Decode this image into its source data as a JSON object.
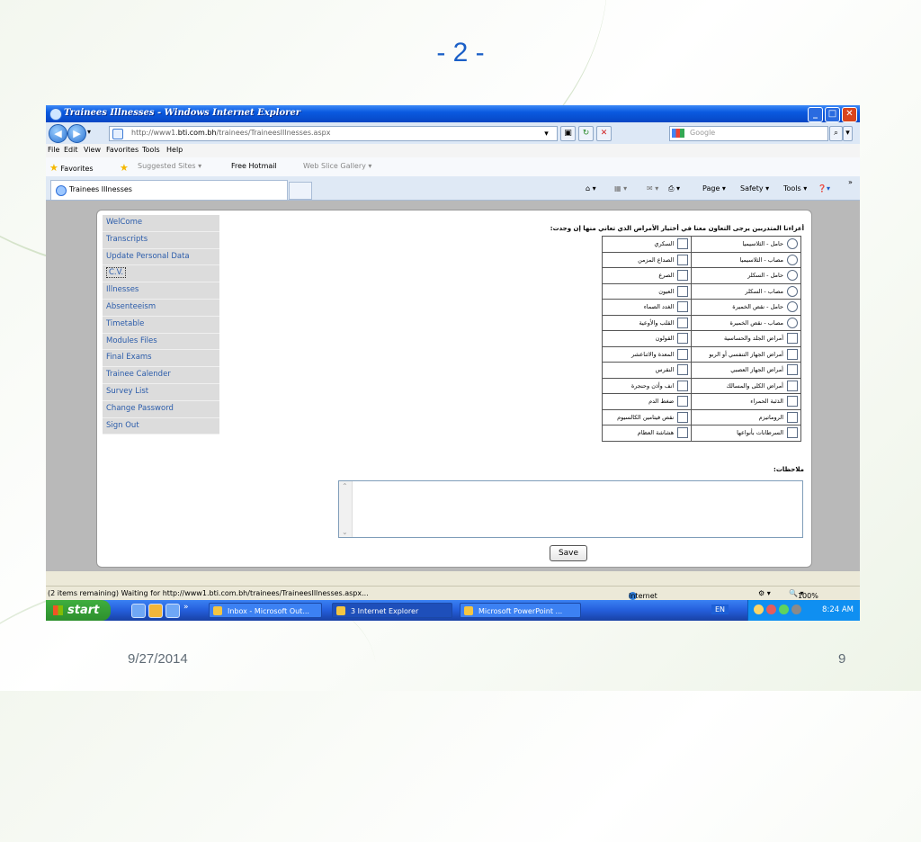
{
  "slide": {
    "title": "- 2 -",
    "date": "9/27/2014",
    "page_number": "9"
  },
  "window": {
    "title": "Trainees Illnesses - Windows Internet Explorer",
    "minimize": "_",
    "maximize": "□",
    "close": "✕"
  },
  "address_bar": {
    "url_prefix": "http://www1.",
    "url_domain": "bti.com.bh",
    "url_path": "/trainees/TraineesIllnesses.aspx",
    "search_placeholder": "Google"
  },
  "menu": [
    "File",
    "Edit",
    "View",
    "Favorites",
    "Tools",
    "Help"
  ],
  "favorites_bar": {
    "favorites_label": "Favorites",
    "items": [
      "Suggested Sites ▾",
      "Free Hotmail",
      "Web Slice Gallery ▾"
    ]
  },
  "tab": {
    "title": "Trainees Illnesses"
  },
  "command_bar": {
    "page": "Page ▾",
    "safety": "Safety ▾",
    "tools": "Tools ▾",
    "help": "❓▾",
    "more": "»"
  },
  "sidebar": {
    "items": [
      {
        "label": "WelCome"
      },
      {
        "label": "Transcripts"
      },
      {
        "label": "Update Personal Data"
      },
      {
        "label": "C.V."
      },
      {
        "label": "Illnesses"
      },
      {
        "label": "Absenteeism"
      },
      {
        "label": "Timetable"
      },
      {
        "label": "Modules Files"
      },
      {
        "label": "Final Exams"
      },
      {
        "label": "Trainee Calender"
      },
      {
        "label": "Survey List"
      },
      {
        "label": "Change Password"
      },
      {
        "label": "Sign Out"
      }
    ]
  },
  "form": {
    "question": "أعزاءنا المتدربين يرجى التعاون معنا في أختيار الأمراض الذي تعاني منها إن وجدت:",
    "rows": [
      {
        "right": "حامل - الثلاسيميا",
        "right_type": "radio",
        "left": "السكري"
      },
      {
        "right": "مصاب - الثلاسيميا",
        "right_type": "radio",
        "left": "الصداع المزمن"
      },
      {
        "right": "حامل - السكلر",
        "right_type": "radio",
        "left": "الصرع"
      },
      {
        "right": "مصاب - السكلر",
        "right_type": "radio",
        "left": "العيون"
      },
      {
        "right": "حامل - نقص الخميرة",
        "right_type": "radio",
        "left": "الغدد الصماء"
      },
      {
        "right": "مصاب - نقص الخميرة",
        "right_type": "radio",
        "left": "القلب والأوعية"
      },
      {
        "right": "أمراض الجلد والحساسية",
        "right_type": "check",
        "left": "القولون"
      },
      {
        "right": "أمراض الجهاز التنفسي أو الربو",
        "right_type": "check",
        "left": "المعدة والاثناعشر"
      },
      {
        "right": "أمراض الجهاز العصبي",
        "right_type": "check",
        "left": "النقرس"
      },
      {
        "right": "أمراض الكلى والمسالك",
        "right_type": "check",
        "left": "انف وأذن وحنجرة"
      },
      {
        "right": "الذئبة الحمراء",
        "right_type": "check",
        "left": "ضغط الدم"
      },
      {
        "right": "الروماتيزم",
        "right_type": "check",
        "left": "نقص فيتامين الكالسيوم"
      },
      {
        "right": "السرطانات بأنواعها",
        "right_type": "check",
        "left": "هشاشة العظام"
      }
    ],
    "notes_label": "ملاحظات:",
    "notes_value": "",
    "save_label": "Save"
  },
  "status_bar": {
    "text": "(2 items remaining) Waiting for http://www1.bti.com.bh/trainees/TraineesIllnesses.aspx...",
    "zone": "Internet",
    "zoom": "100%"
  },
  "taskbar": {
    "start": "start",
    "tasks": [
      "Inbox - Microsoft Out...",
      "3 Internet Explorer",
      "Microsoft PowerPoint ..."
    ],
    "language": "EN",
    "clock": "8:24 AM"
  }
}
